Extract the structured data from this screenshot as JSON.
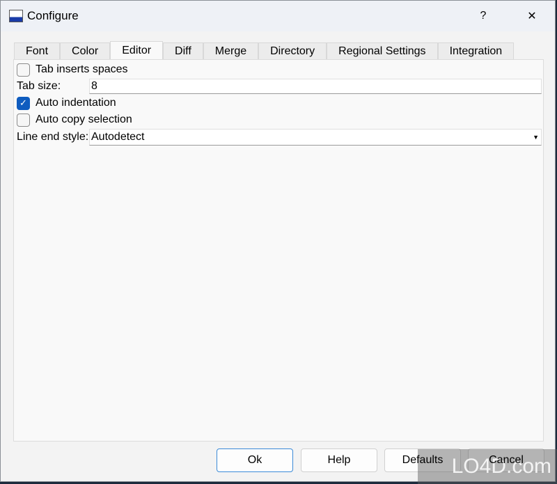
{
  "window": {
    "title": "Configure",
    "help": "?",
    "close": "✕"
  },
  "tabs": [
    "Font",
    "Color",
    "Editor",
    "Diff",
    "Merge",
    "Directory",
    "Regional Settings",
    "Integration"
  ],
  "active_tab": "Editor",
  "editor": {
    "tab_inserts_spaces": {
      "label": "Tab inserts spaces",
      "checked": false
    },
    "tab_size": {
      "label": "Tab size:",
      "value": "8"
    },
    "auto_indentation": {
      "label": "Auto indentation",
      "checked": true
    },
    "auto_copy_selection": {
      "label": "Auto copy selection",
      "checked": false
    },
    "line_end_style": {
      "label": "Line end style:",
      "value": "Autodetect"
    }
  },
  "buttons": {
    "ok": "Ok",
    "help": "Help",
    "defaults": "Defaults",
    "cancel": "Cancel"
  },
  "watermark": "LO4D.com",
  "colors": {
    "accent": "#0f5cbf"
  }
}
